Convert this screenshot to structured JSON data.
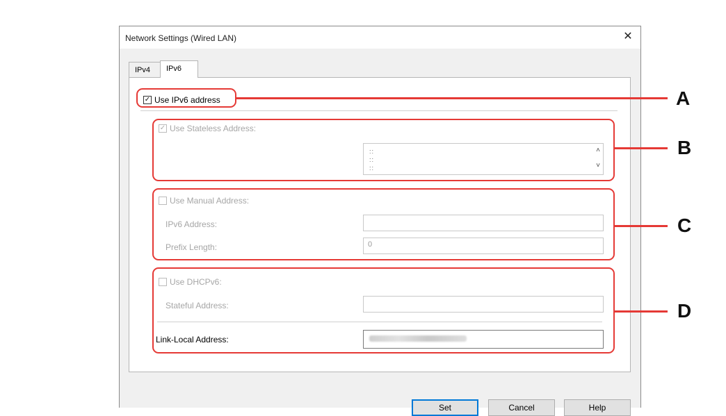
{
  "window": {
    "title": "Network Settings (Wired LAN)",
    "close_glyph": "✕"
  },
  "tabs": [
    {
      "label": "IPv4"
    },
    {
      "label": "IPv6",
      "active": true
    }
  ],
  "use_ipv6": {
    "label": "Use IPv6 address",
    "checked": true
  },
  "stateless": {
    "label": "Use Stateless Address:",
    "checked": true,
    "enabled": false,
    "address_lines": [
      "::",
      "::",
      "::"
    ],
    "scroll_up": "˄",
    "scroll_down": "˅"
  },
  "manual": {
    "label": "Use Manual Address:",
    "checked": false,
    "ipv6_address_label": "IPv6 Address:",
    "ipv6_address_value": "",
    "prefix_length_label": "Prefix Length:",
    "prefix_length_value": "0"
  },
  "dhcpv6": {
    "label": "Use DHCPv6:",
    "checked": false,
    "stateful_address_label": "Stateful Address:",
    "stateful_address_value": ""
  },
  "link_local": {
    "label": "Link-Local Address:",
    "value_obscured": true
  },
  "buttons": {
    "set": "Set",
    "cancel": "Cancel",
    "help": "Help"
  },
  "callouts": [
    "A",
    "B",
    "C",
    "D"
  ],
  "colors": {
    "highlight": "#e53935",
    "default_button_border": "#0078d7",
    "dialog_bg": "#f0f0f0"
  }
}
